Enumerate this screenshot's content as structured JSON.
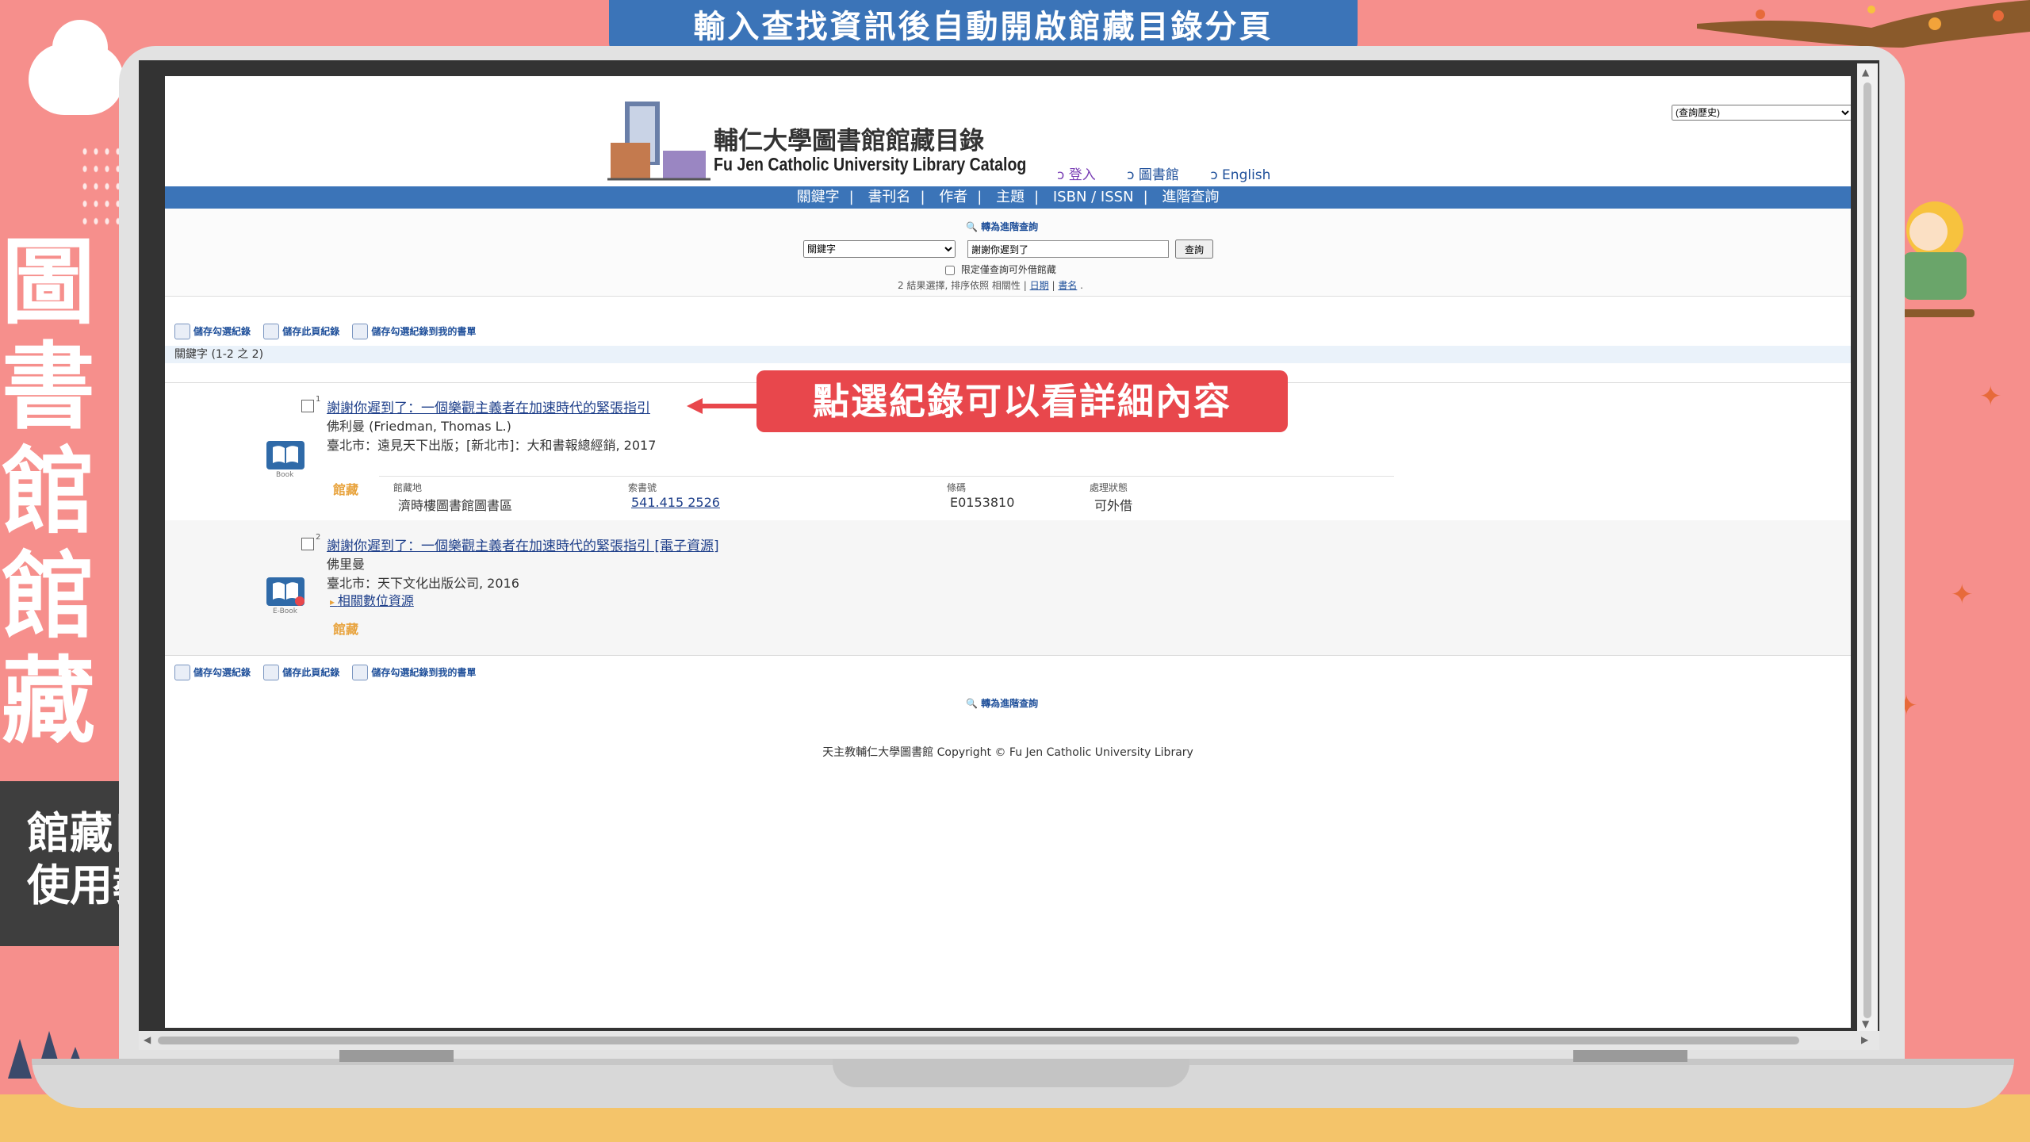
{
  "banner": "輸入查找資訊後自動開啟館藏目錄分頁",
  "side_title": "圖書館館藏",
  "tutorial": {
    "line1": "館藏目錄",
    "line2": "使用教學"
  },
  "callout": "點選紀錄可以看詳細內容",
  "catalog": {
    "logo_title": "輔仁大學圖書館館藏目錄",
    "logo_subtitle": "Fu Jen Catholic University Library Catalog",
    "history_select": "(查詢歷史)",
    "toplinks": {
      "login": "ↄ 登入",
      "library": "ↄ 圖書館",
      "english": "ↄ English"
    },
    "nav": [
      "關鍵字",
      "書刊名",
      "作者",
      "主題",
      "ISBN / ISSN",
      "進階查詢"
    ],
    "advanced_link": "轉為進階查詢",
    "search": {
      "type": "關鍵字",
      "query": "謝謝你遲到了",
      "button": "查詢",
      "limit_label": "限定僅查詢可外借館藏"
    },
    "sort": {
      "prefix": "2 結果選擇, 排序依照 相關性 |",
      "date": "日期",
      "sep": "|",
      "title": "書名",
      "end": "."
    },
    "tools": [
      "儲存勾選紀錄",
      "儲存此頁紀錄",
      "儲存勾選紀錄到我的書單"
    ],
    "result_count": "關鍵字 (1-2 之 2)",
    "records": [
      {
        "num": "1",
        "title": "謝謝你遲到了：一個樂觀主義者在加速時代的緊張指引",
        "author": "佛利曼 (Friedman, Thomas L.)",
        "publisher": "臺北市：遠見天下出版；[新北市]：大和書報總經銷, 2017",
        "format": "Book",
        "holdings_label": "館藏",
        "holdings_headers": [
          "館藏地",
          "索書號",
          "條碼",
          "處理狀態"
        ],
        "holdings_row": [
          "濟時樓圖書館圖書區",
          "541.415 2526",
          "E0153810",
          "可外借"
        ]
      },
      {
        "num": "2",
        "title": "謝謝你遲到了：一個樂觀主義者在加速時代的緊張指引 [電子資源]",
        "author": "佛里曼",
        "publisher": "臺北市：天下文化出版公司, 2016",
        "format": "E-Book",
        "related": "相關數位資源",
        "holdings_label": "館藏"
      }
    ],
    "copyright": "天主教輔仁大學圖書館 Copyright © Fu Jen Catholic University Library"
  },
  "colors": {
    "background": "#f68f8c",
    "banner": "#3b74b8",
    "callout": "#e8474c",
    "holdings": "#e8a33d"
  }
}
